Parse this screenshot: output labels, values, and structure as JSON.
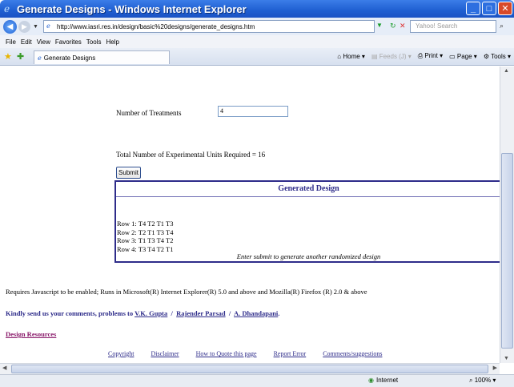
{
  "window": {
    "title": "Generate Designs - Windows Internet Explorer"
  },
  "address_bar": {
    "url": "http://www.iasri.res.in/design/basic%20designs/generate_designs.htm",
    "search_placeholder": "Yahoo! Search"
  },
  "menu": [
    "File",
    "Edit",
    "View",
    "Favorites",
    "Tools",
    "Help"
  ],
  "tab": {
    "label": "Generate Designs"
  },
  "commandbar": {
    "home": "Home",
    "feeds": "Feeds (J)",
    "print": "Print",
    "page": "Page",
    "tools": "Tools"
  },
  "form": {
    "treatments_label": "Number of Treatments",
    "treatments_value": "4",
    "total_units": "Total Number of Experimental Units Required = 16",
    "submit_label": "Submit"
  },
  "design": {
    "heading": "Generated Design",
    "rows": [
      "Row 1: T4 T2 T1 T3",
      "Row 2: T2 T1 T3 T4",
      "Row 3: T1 T3 T4 T2",
      "Row 4: T3 T4 T2 T1"
    ],
    "note": "Enter submit to generate another randomized design"
  },
  "footer": {
    "requirements": "Requires Javascript to be enabled; Runs in Microsoft(R) Internet Explorer(R) 5.0 and above and Mozilla(R) Firefox (R) 2.0 & above",
    "kindly_prefix": "Kindly send us your comments, problems to",
    "contacts": [
      "V.K. Gupta",
      "Rajender Parsad",
      "A. Dhandapani"
    ],
    "design_resources": "Design Resources",
    "links": [
      "Copyright",
      "Disclaimer",
      "How to Quote this page",
      "Report Error",
      "Comments/suggestions"
    ]
  },
  "status": {
    "zone": "Internet",
    "zoom": "100%"
  }
}
